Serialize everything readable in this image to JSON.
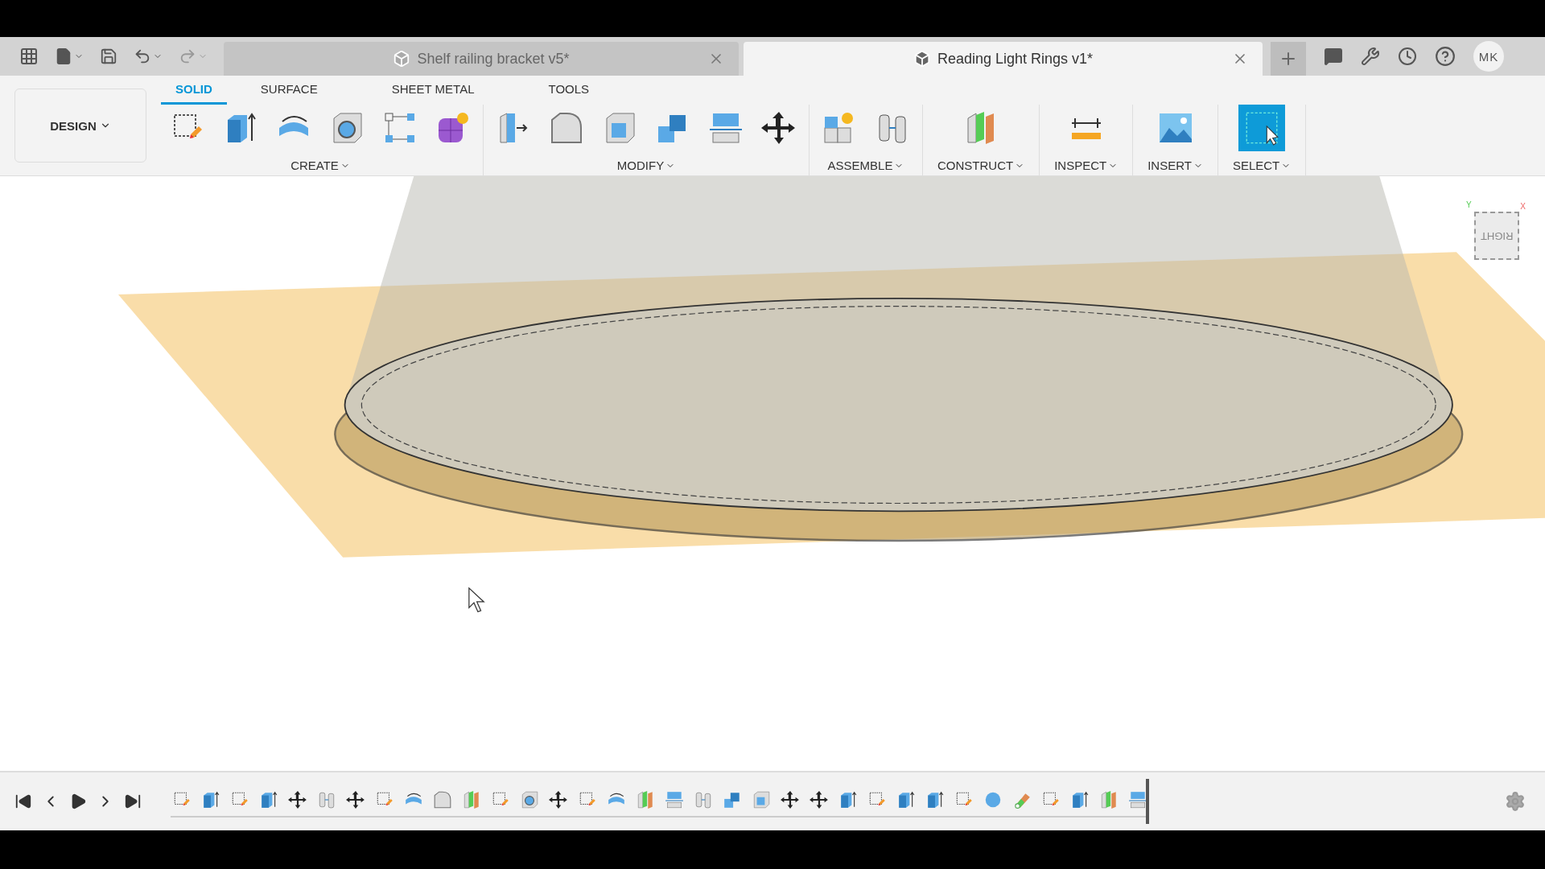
{
  "tabs": [
    {
      "title": "Shelf railing bracket v5*",
      "selected": false
    },
    {
      "title": "Reading Light Rings v1*",
      "selected": true
    }
  ],
  "user": {
    "initials": "MK"
  },
  "workspace": {
    "label": "DESIGN"
  },
  "ribbon_tabs": [
    {
      "label": "SOLID",
      "selected": true
    },
    {
      "label": "SURFACE",
      "selected": false
    },
    {
      "label": "SHEET METAL",
      "selected": false
    },
    {
      "label": "TOOLS",
      "selected": false
    }
  ],
  "ribbon_groups": [
    {
      "label": "CREATE",
      "tools": [
        {
          "kind": "sketch",
          "selected": false
        },
        {
          "kind": "extrude",
          "selected": false
        },
        {
          "kind": "revolve",
          "selected": false
        },
        {
          "kind": "hole",
          "selected": false
        },
        {
          "kind": "pattern",
          "selected": false
        },
        {
          "kind": "form",
          "selected": false
        }
      ]
    },
    {
      "label": "MODIFY",
      "tools": [
        {
          "kind": "presspull",
          "selected": false
        },
        {
          "kind": "fillet",
          "selected": false
        },
        {
          "kind": "shell",
          "selected": false
        },
        {
          "kind": "combine",
          "selected": false
        },
        {
          "kind": "split",
          "selected": false
        },
        {
          "kind": "move",
          "selected": false
        }
      ]
    },
    {
      "label": "ASSEMBLE",
      "tools": [
        {
          "kind": "component",
          "selected": false
        },
        {
          "kind": "joint",
          "selected": false
        }
      ]
    },
    {
      "label": "CONSTRUCT",
      "tools": [
        {
          "kind": "plane",
          "selected": false
        }
      ]
    },
    {
      "label": "INSPECT",
      "tools": [
        {
          "kind": "measure",
          "selected": false
        }
      ]
    },
    {
      "label": "INSERT",
      "tools": [
        {
          "kind": "image",
          "selected": false
        }
      ]
    },
    {
      "label": "SELECT",
      "tools": [
        {
          "kind": "select",
          "selected": true
        }
      ]
    }
  ],
  "viewcube": {
    "face": "RIGHT",
    "y_axis": "Y",
    "x_axis": "X"
  },
  "timeline": {
    "features": [
      {
        "kind": "sketch"
      },
      {
        "kind": "extrude"
      },
      {
        "kind": "sketch"
      },
      {
        "kind": "extrude"
      },
      {
        "kind": "move"
      },
      {
        "kind": "joint"
      },
      {
        "kind": "move"
      },
      {
        "kind": "sketch"
      },
      {
        "kind": "revolve"
      },
      {
        "kind": "fillet"
      },
      {
        "kind": "plane"
      },
      {
        "kind": "sketch"
      },
      {
        "kind": "hole"
      },
      {
        "kind": "move"
      },
      {
        "kind": "sketch"
      },
      {
        "kind": "revolve"
      },
      {
        "kind": "plane"
      },
      {
        "kind": "split"
      },
      {
        "kind": "joint"
      },
      {
        "kind": "combine"
      },
      {
        "kind": "shell"
      },
      {
        "kind": "move"
      },
      {
        "kind": "move"
      },
      {
        "kind": "extrude"
      },
      {
        "kind": "sketch"
      },
      {
        "kind": "extrude"
      },
      {
        "kind": "extrude"
      },
      {
        "kind": "sketch"
      },
      {
        "kind": "sphere"
      },
      {
        "kind": "pipe"
      },
      {
        "kind": "sketch"
      },
      {
        "kind": "extrude"
      },
      {
        "kind": "plane"
      },
      {
        "kind": "split"
      }
    ]
  }
}
